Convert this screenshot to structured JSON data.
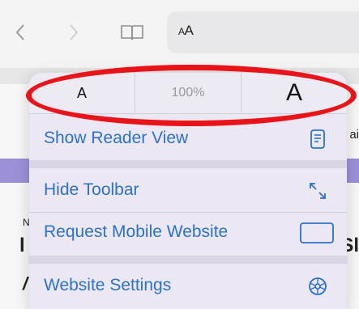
{
  "toolbar": {
    "back_icon": "chevron-left-icon",
    "forward_icon": "chevron-right-icon",
    "bookmarks_icon": "book-icon",
    "text_size_button_label": "AA"
  },
  "page_peek": {
    "right_text": "ai",
    "left_n": "N",
    "left_bold": "l",
    "left_italic": "/",
    "right_bold": "Sl"
  },
  "popover": {
    "decrease_font_label": "A",
    "zoom_level": "100%",
    "increase_font_label": "A",
    "items": [
      {
        "label": "Show Reader View",
        "icon": "reader-view-icon"
      },
      {
        "label": "Hide Toolbar",
        "icon": "resize-arrows-icon"
      },
      {
        "label": "Request Mobile Website",
        "icon": "tablet-icon"
      },
      {
        "label": "Website Settings",
        "icon": "gear-icon"
      }
    ]
  },
  "colors": {
    "accent": "#2d71c9",
    "annotation": "#e8141a",
    "popover_bg": "#ebe8f4"
  }
}
